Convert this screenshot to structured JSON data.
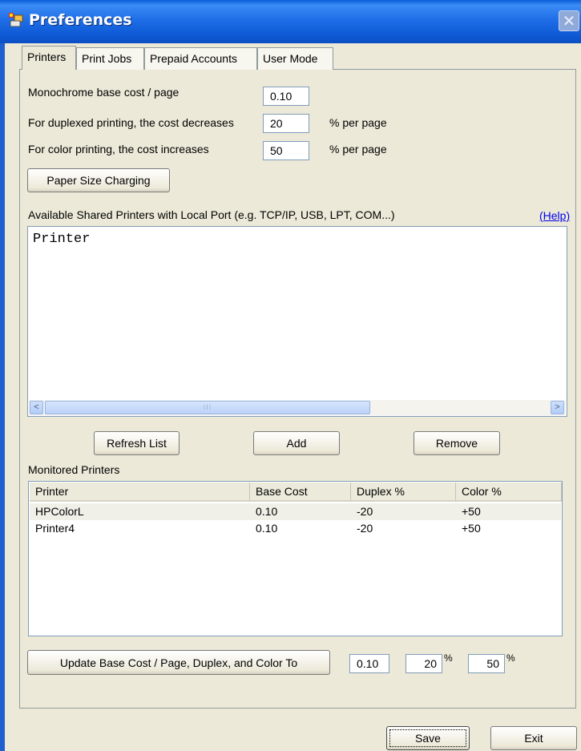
{
  "window": {
    "title": "Preferences",
    "close_glyph": "✕"
  },
  "tabs": [
    {
      "label": "Printers"
    },
    {
      "label": "Print Jobs"
    },
    {
      "label": "Prepaid Accounts"
    },
    {
      "label": "User Mode"
    }
  ],
  "settings": {
    "mono_label": "Monochrome base cost / page",
    "mono_value": "0.10",
    "duplex_label": "For duplexed printing, the cost decreases",
    "duplex_value": "20",
    "duplex_unit": "% per page",
    "color_label": "For color printing, the cost increases",
    "color_value": "50",
    "color_unit": "% per page",
    "paper_button": "Paper Size Charging"
  },
  "shared": {
    "label": "Available Shared Printers with Local Port (e.g. TCP/IP, USB, LPT, COM...)",
    "help": "(Help)",
    "items": [
      "Printer"
    ],
    "scroll_left": "<",
    "scroll_right": ">",
    "thumb_grip": "III"
  },
  "actions": {
    "refresh": "Refresh List",
    "add": "Add",
    "remove": "Remove"
  },
  "monitored": {
    "label": "Monitored Printers",
    "columns": [
      "Printer",
      "Base Cost",
      "Duplex %",
      "Color %"
    ],
    "rows": [
      [
        "HPColorL",
        "0.10",
        "-20",
        "+50"
      ],
      [
        "Printer4",
        "0.10",
        "-20",
        "+50"
      ]
    ]
  },
  "update": {
    "button": "Update  Base Cost / Page, Duplex, and Color To",
    "base_value": "0.10",
    "duplex_value": "20",
    "color_value": "50",
    "pct": "%"
  },
  "footer": {
    "save": "Save",
    "exit": "Exit"
  }
}
